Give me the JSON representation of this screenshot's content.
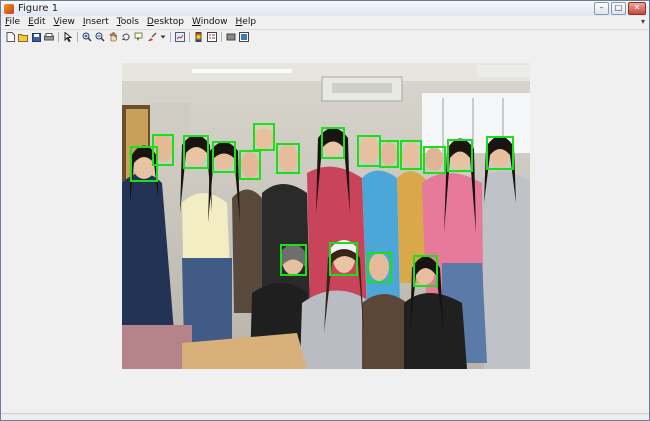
{
  "window": {
    "title": "Figure 1"
  },
  "menu": [
    "File",
    "Edit",
    "View",
    "Insert",
    "Tools",
    "Desktop",
    "Window",
    "Help"
  ],
  "menu_underline": [
    "F",
    "E",
    "V",
    "I",
    "T",
    "D",
    "W",
    "H"
  ],
  "toolbar_icons": [
    "new-figure-icon",
    "open-file-icon",
    "save-icon",
    "print-icon",
    "edit-plot-icon",
    "zoom-in-icon",
    "zoom-out-icon",
    "pan-icon",
    "rotate-3d-icon",
    "data-cursor-icon",
    "brush-icon",
    "link-plot-icon",
    "insert-colorbar-icon",
    "insert-legend-icon",
    "hide-plot-tools-icon",
    "show-plot-tools-icon"
  ],
  "detections": {
    "label": "face",
    "count": 21
  }
}
